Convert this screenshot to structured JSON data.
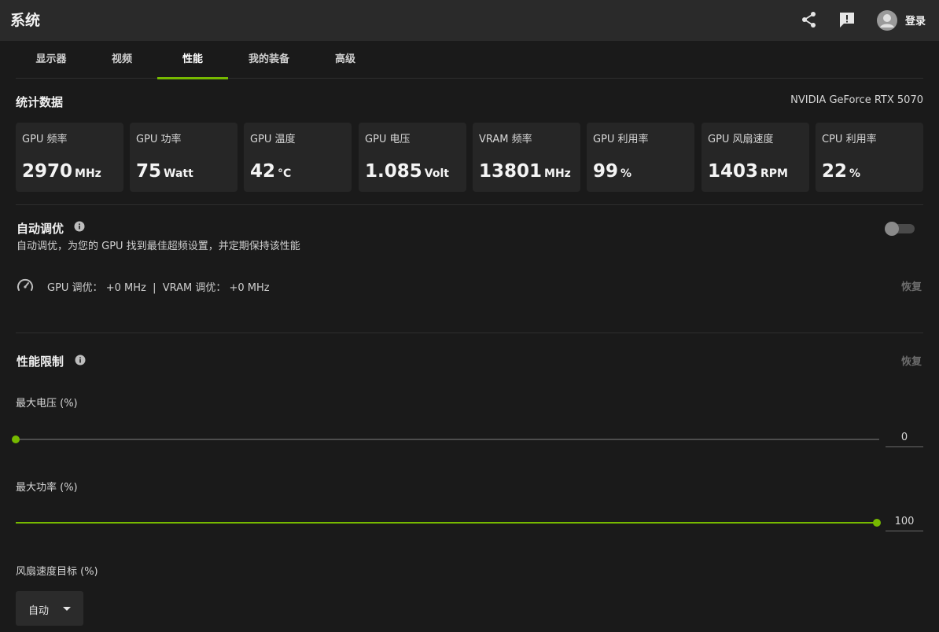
{
  "app": {
    "title": "系统"
  },
  "header": {
    "share_icon": "share-icon",
    "feedback_icon": "feedback-icon",
    "login_label": "登录"
  },
  "tabs": [
    {
      "label": "显示器"
    },
    {
      "label": "视频"
    },
    {
      "label": "性能",
      "active": true
    },
    {
      "label": "我的装备"
    },
    {
      "label": "高级"
    }
  ],
  "stats": {
    "title": "统计数据",
    "gpu_name": "NVIDIA GeForce RTX 5070",
    "cards": [
      {
        "label": "GPU 频率",
        "value": "2970",
        "unit": "MHz"
      },
      {
        "label": "GPU 功率",
        "value": "75",
        "unit": "Watt"
      },
      {
        "label": "GPU 温度",
        "value": "42",
        "unit": "°C"
      },
      {
        "label": "GPU 电压",
        "value": "1.085",
        "unit": "Volt"
      },
      {
        "label": "VRAM 频率",
        "value": "13801",
        "unit": "MHz"
      },
      {
        "label": "GPU 利用率",
        "value": "99",
        "unit": "%"
      },
      {
        "label": "GPU 风扇速度",
        "value": "1403",
        "unit": "RPM"
      },
      {
        "label": "CPU 利用率",
        "value": "22",
        "unit": "%"
      }
    ]
  },
  "autotune": {
    "title": "自动调优",
    "description": "自动调优，为您的 GPU 找到最佳超频设置，并定期保持该性能",
    "enabled": false,
    "oc_text": "GPU 调优： +0 MHz  |  VRAM 调优： +0 MHz",
    "restore_label": "恢复"
  },
  "limits": {
    "title": "性能限制",
    "restore_label": "恢复",
    "sliders": [
      {
        "label": "最大电压 (%)",
        "value": "0",
        "fraction": 0
      },
      {
        "label": "最大功率 (%)",
        "value": "100",
        "fraction": 1
      }
    ],
    "fan": {
      "label": "风扇速度目标 (%)",
      "selected": "自动"
    }
  },
  "colors": {
    "accent": "#76b900",
    "background": "#1a1a1a",
    "card": "#262626",
    "titlebar": "#2a2a2a"
  }
}
